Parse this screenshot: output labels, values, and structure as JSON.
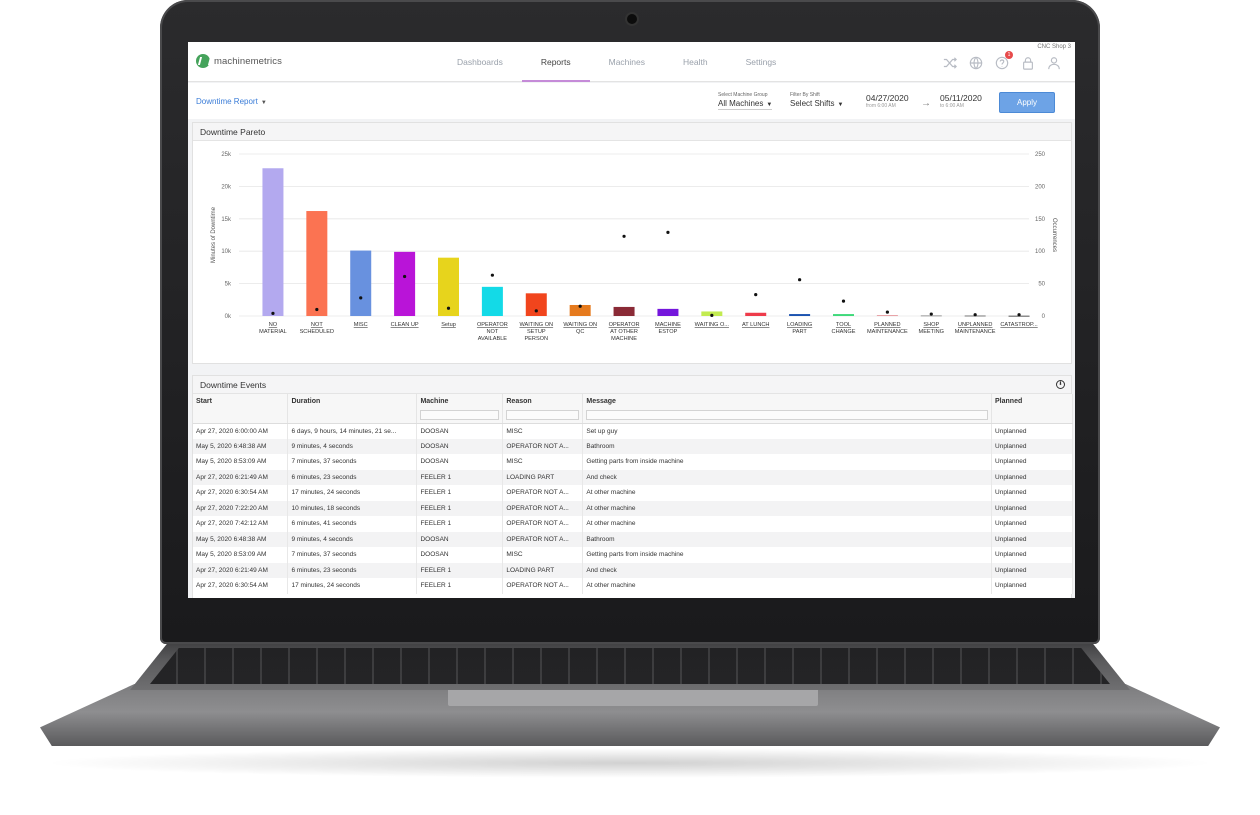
{
  "app": {
    "brand": "machinemetrics",
    "shop": "CNC Shop 3",
    "notification_count": "1"
  },
  "nav": {
    "tabs": [
      {
        "label": "Dashboards",
        "active": false
      },
      {
        "label": "Reports",
        "active": true
      },
      {
        "label": "Machines",
        "active": false
      },
      {
        "label": "Health",
        "active": false
      },
      {
        "label": "Settings",
        "active": false
      }
    ],
    "icons": [
      "shuffle-icon",
      "globe-icon",
      "help-icon",
      "lock-icon",
      "user-icon"
    ]
  },
  "filters": {
    "report": "Downtime Report",
    "machine_group_label": "Select Machine Group",
    "machine_group_value": "All Machines",
    "shift_label": "Filter By Shift",
    "shift_value": "Select Shifts",
    "start_date": "04/27/2020",
    "start_time": "from 6:00 AM",
    "end_date": "05/11/2020",
    "end_time": "to 6:00 AM",
    "apply": "Apply"
  },
  "pareto": {
    "title": "Downtime Pareto"
  },
  "chart_data": {
    "type": "bar",
    "title": "Downtime Pareto",
    "ylabel": "Minutes of Downtime",
    "y2label": "Occurrences",
    "ylim": [
      0,
      25000
    ],
    "y2lim": [
      0,
      250
    ],
    "yticks": [
      "0k",
      "5k",
      "10k",
      "15k",
      "20k",
      "25k"
    ],
    "y2ticks": [
      "0",
      "50",
      "100",
      "150",
      "200",
      "250"
    ],
    "grid": true,
    "categories": [
      [
        "NO",
        "MATERIAL"
      ],
      [
        "NOT",
        "SCHEDULED"
      ],
      [
        "MISC"
      ],
      [
        "CLEAN UP"
      ],
      [
        "Setup"
      ],
      [
        "OPERATOR",
        "NOT",
        "AVAILABLE"
      ],
      [
        "WAITING ON",
        "SETUP",
        "PERSON"
      ],
      [
        "WAITING ON",
        "QC"
      ],
      [
        "OPERATOR",
        "AT OTHER",
        "MACHINE"
      ],
      [
        "MACHINE",
        "ESTOP"
      ],
      [
        "WAITING O..."
      ],
      [
        "AT LUNCH"
      ],
      [
        "LOADING",
        "PART"
      ],
      [
        "TOOL",
        "CHANGE"
      ],
      [
        "PLANNED",
        "MAINTENANCE"
      ],
      [
        "SHOP",
        "MEETING"
      ],
      [
        "UNPLANNED",
        "MAINTENANCE"
      ],
      [
        "CATASTROP..."
      ]
    ],
    "series": [
      {
        "axis": "left",
        "values": [
          22800,
          16200,
          10100,
          9900,
          9000,
          4500,
          3500,
          1700,
          1400,
          1100,
          700,
          500,
          300,
          300,
          150,
          100,
          80,
          50
        ],
        "colors": [
          "#b3a9ef",
          "#fb7352",
          "#6891df",
          "#b914d8",
          "#e7d41c",
          "#13dae7",
          "#f1451d",
          "#e57a1d",
          "#8a2a36",
          "#7416dc",
          "#c2eb50",
          "#ee3b4a",
          "#1c53b0",
          "#3fd97b",
          "#e8a2a6",
          "#999999",
          "#777777",
          "#555555"
        ]
      },
      {
        "axis": "right",
        "type": "scatter",
        "values": [
          4,
          10,
          28,
          61,
          12,
          63,
          8,
          15,
          123,
          129,
          1,
          33,
          56,
          23,
          6,
          3,
          2,
          2
        ]
      }
    ]
  },
  "events": {
    "title": "Downtime Events",
    "columns": [
      "Start",
      "Duration",
      "Machine",
      "Reason",
      "Message",
      "Planned"
    ],
    "rows": [
      [
        "Apr 27, 2020 6:00:00 AM",
        "6 days, 9 hours, 14 minutes, 21 se...",
        "DOOSAN",
        "MISC",
        "Set up guy",
        "Unplanned"
      ],
      [
        "May 5, 2020 6:48:38 AM",
        "9 minutes, 4 seconds",
        "DOOSAN",
        "OPERATOR NOT A...",
        "Bathroom",
        "Unplanned"
      ],
      [
        "May 5, 2020 8:53:09 AM",
        "7 minutes, 37 seconds",
        "DOOSAN",
        "MISC",
        "Getting parts from inside machine",
        "Unplanned"
      ],
      [
        "Apr 27, 2020 6:21:49 AM",
        "6 minutes, 23 seconds",
        "FEELER 1",
        "LOADING PART",
        "And check",
        "Unplanned"
      ],
      [
        "Apr 27, 2020 6:30:54 AM",
        "17 minutes, 24 seconds",
        "FEELER 1",
        "OPERATOR NOT A...",
        "At other machine",
        "Unplanned"
      ],
      [
        "Apr 27, 2020 7:22:20 AM",
        "10 minutes, 18 seconds",
        "FEELER 1",
        "OPERATOR NOT A...",
        "At other machine",
        "Unplanned"
      ],
      [
        "Apr 27, 2020 7:42:12 AM",
        "6 minutes, 41 seconds",
        "FEELER 1",
        "OPERATOR NOT A...",
        "At other machine",
        "Unplanned"
      ],
      [
        "May 5, 2020 6:48:38 AM",
        "9 minutes, 4 seconds",
        "DOOSAN",
        "OPERATOR NOT A...",
        "Bathroom",
        "Unplanned"
      ],
      [
        "May 5, 2020 8:53:09 AM",
        "7 minutes, 37 seconds",
        "DOOSAN",
        "MISC",
        "Getting parts from inside machine",
        "Unplanned"
      ],
      [
        "Apr 27, 2020 6:21:49 AM",
        "6 minutes, 23 seconds",
        "FEELER 1",
        "LOADING PART",
        "And check",
        "Unplanned"
      ],
      [
        "Apr 27, 2020 6:30:54 AM",
        "17 minutes, 24 seconds",
        "FEELER 1",
        "OPERATOR NOT A...",
        "At other machine",
        "Unplanned"
      ]
    ]
  }
}
